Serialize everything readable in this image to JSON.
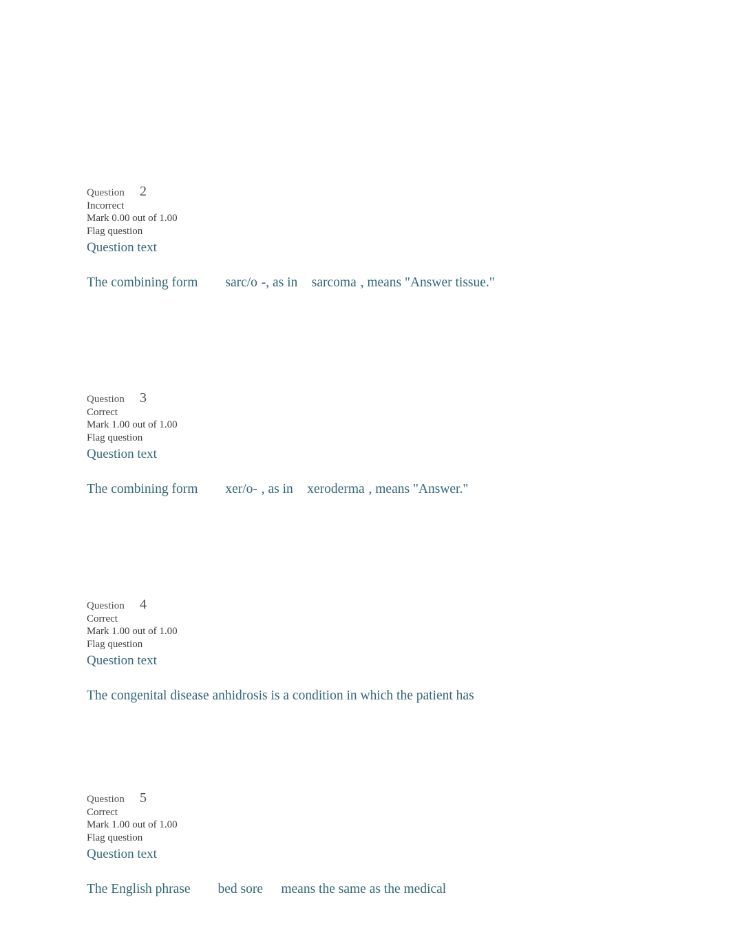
{
  "page": {
    "background": "#ffffff",
    "text_color": "#333333",
    "accent_color": "#336677"
  },
  "labels": {
    "question_word": "Question",
    "question_text_heading": "Question text",
    "flag_question": "Flag question"
  },
  "questions": [
    {
      "number": "2",
      "state": "Incorrect",
      "grade": "Mark 0.00 out of 1.00",
      "flag": "Flag question",
      "heading": "Question text",
      "parts": [
        {
          "kind": "plain",
          "text": "The combining form"
        },
        {
          "kind": "term",
          "text": "sarc/o"
        },
        {
          "kind": "plain",
          "text": "-, as in"
        },
        {
          "kind": "term-tight",
          "text": "sarcoma"
        },
        {
          "kind": "plain",
          "text": ", means \"Answer tissue.\""
        }
      ]
    },
    {
      "number": "3",
      "state": "Correct",
      "grade": "Mark 1.00 out of 1.00",
      "flag": "Flag question",
      "heading": "Question text",
      "parts": [
        {
          "kind": "plain",
          "text": "The combining form"
        },
        {
          "kind": "term",
          "text": "xer/o-"
        },
        {
          "kind": "plain",
          "text": ", as in"
        },
        {
          "kind": "term-tight",
          "text": "xeroderma"
        },
        {
          "kind": "plain",
          "text": ", means \"Answer.\""
        }
      ]
    },
    {
      "number": "4",
      "state": "Correct",
      "grade": "Mark 1.00 out of 1.00",
      "flag": "Flag question",
      "heading": "Question text",
      "parts": [
        {
          "kind": "plain",
          "text": "The congenital disease anhidrosis is a condition in which the patient has"
        }
      ]
    },
    {
      "number": "5",
      "state": "Correct",
      "grade": "Mark 1.00 out of 1.00",
      "flag": "Flag question",
      "heading": "Question text",
      "parts": [
        {
          "kind": "plain",
          "text": "The English phrase"
        },
        {
          "kind": "term",
          "text": "bed sore"
        },
        {
          "kind": "plain-gap",
          "text": "means the same as the medical"
        }
      ]
    }
  ]
}
